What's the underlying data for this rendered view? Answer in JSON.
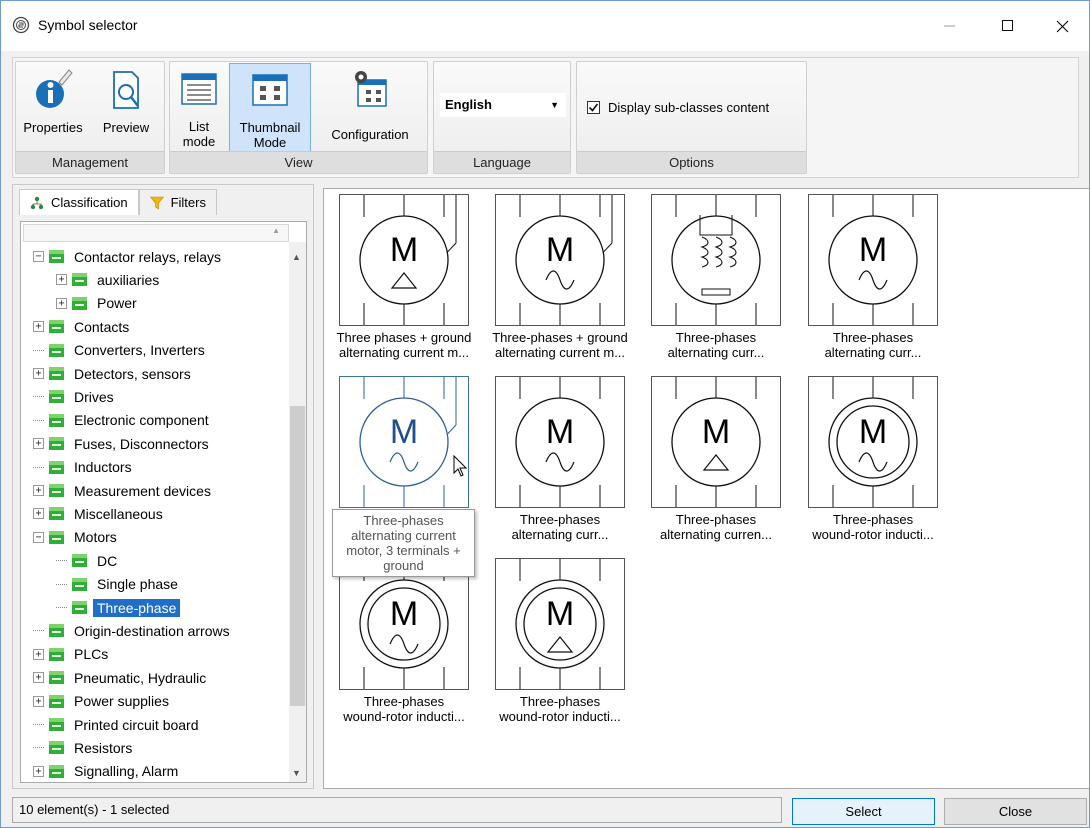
{
  "window": {
    "title": "Symbol selector"
  },
  "ribbon": {
    "management": {
      "label": "Management",
      "properties": "Properties",
      "preview": "Preview"
    },
    "view": {
      "label": "View",
      "list_mode": [
        "List",
        "mode"
      ],
      "thumbnail_mode": [
        "Thumbnail",
        "Mode"
      ],
      "configuration": "Configuration"
    },
    "language": {
      "label": "Language",
      "selected": "English"
    },
    "options": {
      "label": "Options",
      "display_subclasses": "Display sub-classes content",
      "display_subclasses_checked": true
    }
  },
  "left_pane": {
    "tabs": [
      {
        "label": "Classification",
        "icon": "classification-icon"
      },
      {
        "label": "Filters",
        "icon": "filter-funnel-icon"
      }
    ],
    "tree": [
      {
        "label": "Contactor relays, relays",
        "depth": 0,
        "expander": "minus"
      },
      {
        "label": "auxiliaries",
        "depth": 1,
        "expander": "plus"
      },
      {
        "label": "Power",
        "depth": 1,
        "expander": "plus"
      },
      {
        "label": "Contacts",
        "depth": 0,
        "expander": "plus"
      },
      {
        "label": "Converters, Inverters",
        "depth": 0,
        "expander": "none"
      },
      {
        "label": "Detectors, sensors",
        "depth": 0,
        "expander": "plus"
      },
      {
        "label": "Drives",
        "depth": 0,
        "expander": "none"
      },
      {
        "label": "Electronic component",
        "depth": 0,
        "expander": "none"
      },
      {
        "label": "Fuses, Disconnectors",
        "depth": 0,
        "expander": "plus"
      },
      {
        "label": "Inductors",
        "depth": 0,
        "expander": "none"
      },
      {
        "label": "Measurement devices",
        "depth": 0,
        "expander": "plus"
      },
      {
        "label": "Miscellaneous",
        "depth": 0,
        "expander": "plus"
      },
      {
        "label": "Motors",
        "depth": 0,
        "expander": "minus"
      },
      {
        "label": "DC",
        "depth": 1,
        "expander": "none"
      },
      {
        "label": "Single phase",
        "depth": 1,
        "expander": "none"
      },
      {
        "label": "Three-phase",
        "depth": 1,
        "expander": "none",
        "selected": true
      },
      {
        "label": "Origin-destination arrows",
        "depth": 0,
        "expander": "none"
      },
      {
        "label": "PLCs",
        "depth": 0,
        "expander": "plus"
      },
      {
        "label": "Pneumatic, Hydraulic",
        "depth": 0,
        "expander": "plus"
      },
      {
        "label": "Power supplies",
        "depth": 0,
        "expander": "plus"
      },
      {
        "label": "Printed circuit board",
        "depth": 0,
        "expander": "none"
      },
      {
        "label": "Resistors",
        "depth": 0,
        "expander": "none"
      },
      {
        "label": "Signalling, Alarm",
        "depth": 0,
        "expander": "plus"
      }
    ]
  },
  "thumbnails": [
    {
      "caption": [
        "Three phases + ground",
        "alternating current m..."
      ],
      "symbol": "M",
      "sub": "triangle",
      "ground": true,
      "double": false
    },
    {
      "caption": [
        "Three-phases + ground",
        "alternating current m..."
      ],
      "symbol": "M",
      "sub": "wave",
      "ground": true,
      "double": false
    },
    {
      "caption": [
        "Three-phases",
        "alternating curr..."
      ],
      "symbol": "",
      "sub": "coils",
      "ground": false,
      "double": false
    },
    {
      "caption": [
        "Three-phases",
        "alternating curr..."
      ],
      "symbol": "M",
      "sub": "wave",
      "ground": false,
      "double": false
    },
    {
      "caption": [
        "",
        ""
      ],
      "symbol": "M",
      "sub": "wave",
      "ground": true,
      "double": false,
      "hover": true
    },
    {
      "caption": [
        "Three-phases",
        "alternating curr..."
      ],
      "symbol": "M",
      "sub": "wave",
      "ground": false,
      "double": false
    },
    {
      "caption": [
        "Three-phases",
        "alternating curren..."
      ],
      "symbol": "M",
      "sub": "triangle",
      "ground": false,
      "double": false
    },
    {
      "caption": [
        "Three-phases",
        "wound-rotor inducti..."
      ],
      "symbol": "M",
      "sub": "wave",
      "ground": false,
      "double": true
    },
    {
      "caption": [
        "Three-phases",
        "wound-rotor inducti..."
      ],
      "symbol": "M",
      "sub": "wave",
      "ground": false,
      "double": true
    },
    {
      "caption": [
        "Three-phases",
        "wound-rotor inducti..."
      ],
      "symbol": "M",
      "sub": "triangle",
      "ground": false,
      "double": true
    }
  ],
  "tooltip": {
    "lines": [
      "Three-phases",
      "alternating current",
      "motor, 3 terminals +",
      "ground"
    ]
  },
  "status": {
    "text": "10 element(s) - 1 selected"
  },
  "buttons": {
    "select": "Select",
    "close": "Close"
  }
}
